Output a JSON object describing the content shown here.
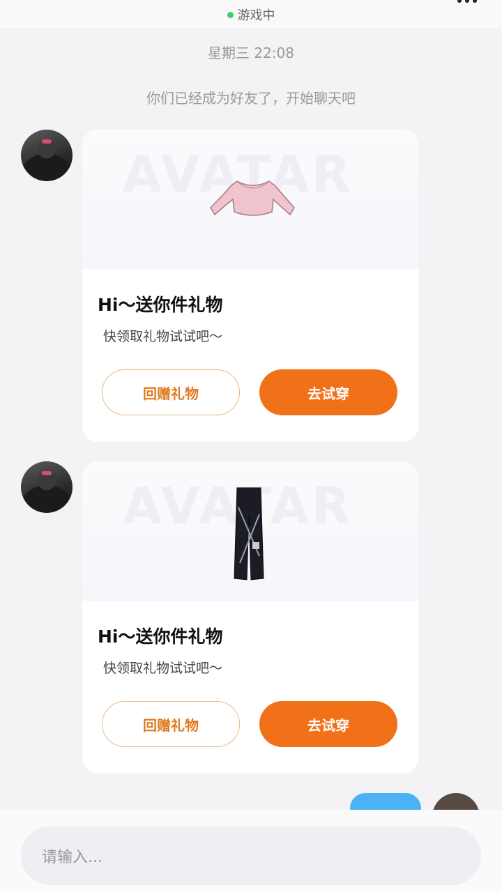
{
  "header": {
    "status_text": "游戏中",
    "status_color": "#3ad16a"
  },
  "chat": {
    "timestamp": "星期三 22:08",
    "system_note": "你们已经成为好友了，开始聊天吧",
    "messages": [
      {
        "type": "gift-card",
        "item_icon": "pink-sweater-icon",
        "watermark": "AVATAR",
        "title": "Hi～送你件礼物",
        "subtitle": "快领取礼物试试吧～",
        "return_gift_label": "回赠礼物",
        "try_on_label": "去试穿"
      },
      {
        "type": "gift-card",
        "item_icon": "black-pants-icon",
        "watermark": "AVATAR",
        "title": "Hi～送你件礼物",
        "subtitle": "快领取礼物试试吧～",
        "return_gift_label": "回赠礼物",
        "try_on_label": "去试穿"
      }
    ]
  },
  "input": {
    "placeholder": "请输入..."
  },
  "colors": {
    "accent": "#f07118",
    "outline": "#e4b98a",
    "self_bubble": "#4bb3f5"
  }
}
